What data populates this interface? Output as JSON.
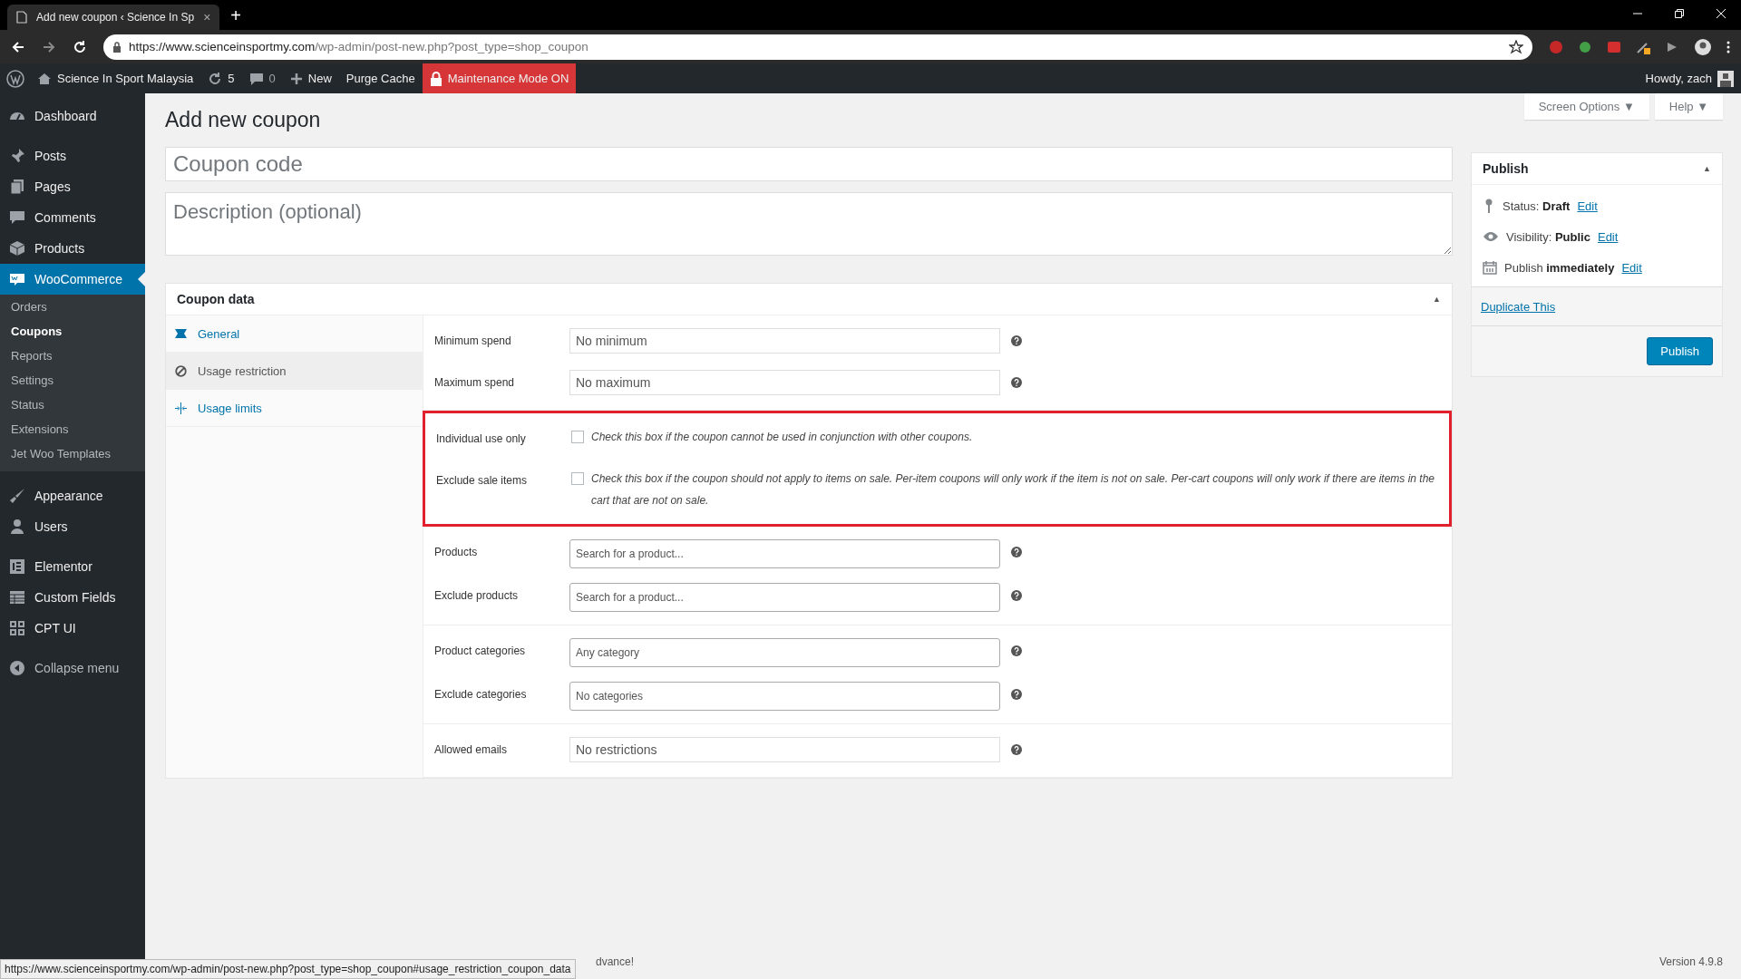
{
  "browser": {
    "tab_title": "Add new coupon ‹ Science In Sp",
    "tab_close": "×",
    "new_tab": "+",
    "url_host": "https://www.scienceinsportmy.com",
    "url_path": "/wp-admin/post-new.php?post_type=shop_coupon"
  },
  "admin_bar": {
    "site_name": "Science In Sport Malaysia",
    "updates": "5",
    "comments": "0",
    "new": "New",
    "purge": "Purge Cache",
    "maintenance": "Maintenance Mode ON",
    "howdy": "Howdy, zach"
  },
  "sidebar": {
    "groups": [
      [
        {
          "label": "Dashboard",
          "kind": "main",
          "selected": false
        }
      ],
      [
        {
          "label": "Posts",
          "kind": "main",
          "selected": false
        },
        {
          "label": "Pages",
          "kind": "main",
          "selected": false
        },
        {
          "label": "Comments",
          "kind": "main",
          "selected": false
        },
        {
          "label": "Products",
          "kind": "main",
          "selected": false
        },
        {
          "label": "WooCommerce",
          "kind": "main",
          "selected": true
        },
        {
          "label": "Orders",
          "kind": "sub",
          "selected": false
        },
        {
          "label": "Coupons",
          "kind": "sub",
          "selected": true
        },
        {
          "label": "Reports",
          "kind": "sub",
          "selected": false
        },
        {
          "label": "Settings",
          "kind": "sub",
          "selected": false
        },
        {
          "label": "Status",
          "kind": "sub",
          "selected": false
        },
        {
          "label": "Extensions",
          "kind": "sub",
          "selected": false
        },
        {
          "label": "Jet Woo Templates",
          "kind": "sub",
          "selected": false
        }
      ],
      [
        {
          "label": "Appearance",
          "kind": "main",
          "selected": false
        },
        {
          "label": "Users",
          "kind": "main",
          "selected": false
        }
      ],
      [
        {
          "label": "Elementor",
          "kind": "main",
          "selected": false
        },
        {
          "label": "Custom Fields",
          "kind": "main",
          "selected": false
        },
        {
          "label": "CPT UI",
          "kind": "main",
          "selected": false
        }
      ],
      [
        {
          "label": "Collapse menu",
          "kind": "collapse",
          "selected": false
        }
      ]
    ]
  },
  "screen_options": [
    {
      "label": "Screen Options",
      "caret": "▼"
    },
    {
      "label": "Help",
      "caret": "▼"
    }
  ],
  "page_title": "Add new coupon",
  "coupon_code": {
    "placeholder": "Coupon code"
  },
  "description": {
    "placeholder": "Description (optional)"
  },
  "coupon_data": {
    "title": "Coupon data",
    "toggle": "▲",
    "tabs": [
      {
        "label": "General",
        "selected": false
      },
      {
        "label": "Usage restriction",
        "selected": true
      },
      {
        "label": "Usage limits",
        "selected": false
      }
    ],
    "groups": [
      {
        "highlighted": false,
        "rows": [
          {
            "kind": "input",
            "label": "Minimum spend",
            "placeholder": "No minimum"
          },
          {
            "kind": "input",
            "label": "Maximum spend",
            "placeholder": "No maximum"
          }
        ]
      },
      {
        "highlighted": true,
        "rows": [
          {
            "kind": "checkbox",
            "label": "Individual use only",
            "checked": false,
            "description": "Check this box if the coupon cannot be used in conjunction with other coupons."
          },
          {
            "kind": "checkbox",
            "label": "Exclude sale items",
            "checked": false,
            "description": "Check this box if the coupon should not apply to items on sale. Per-item coupons will only work if the item is not on sale. Per-cart coupons will only work if there are items in the cart that are not on sale."
          }
        ]
      },
      {
        "highlighted": false,
        "rows": [
          {
            "kind": "select",
            "label": "Products",
            "placeholder": "Search for a product..."
          },
          {
            "kind": "select",
            "label": "Exclude products",
            "placeholder": "Search for a product..."
          }
        ]
      },
      {
        "highlighted": false,
        "rows": [
          {
            "kind": "select",
            "label": "Product categories",
            "placeholder": "Any category"
          },
          {
            "kind": "select",
            "label": "Exclude categories",
            "placeholder": "No categories"
          }
        ]
      },
      {
        "highlighted": false,
        "rows": [
          {
            "kind": "input",
            "label": "Allowed emails",
            "placeholder": "No restrictions"
          }
        ]
      }
    ]
  },
  "publish": {
    "title": "Publish",
    "toggle": "▲",
    "rows": [
      {
        "label": "Status:",
        "value": "Draft",
        "link": "Edit"
      },
      {
        "label": "Visibility:",
        "value": "Public",
        "link": "Edit"
      },
      {
        "label": "Publish",
        "value": "immediately",
        "link": "Edit"
      }
    ],
    "duplicate": "Duplicate This",
    "button": "Publish"
  },
  "footer": {
    "thanks_visible": "dvance!",
    "version": "Version 4.9.8"
  },
  "status_url": "https://www.scienceinsportmy.com/wp-admin/post-new.php?post_type=shop_coupon#usage_restriction_coupon_data"
}
